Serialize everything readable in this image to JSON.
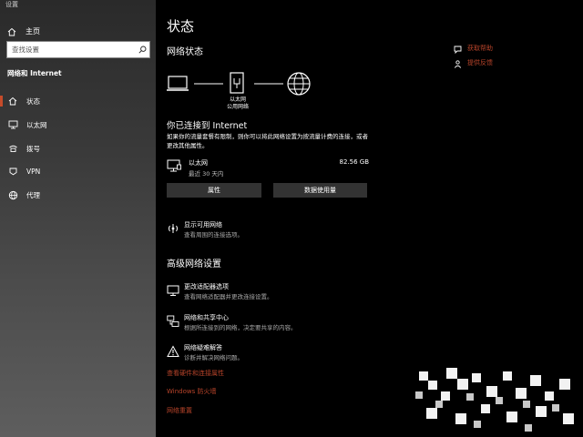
{
  "window": {
    "title": "设置"
  },
  "sidebar": {
    "home_label": "主页",
    "search_placeholder": "查找设置",
    "section_title": "网络和 Internet",
    "items": [
      {
        "label": "状态",
        "icon": "home-status-icon",
        "active": true
      },
      {
        "label": "以太网",
        "icon": "ethernet-icon"
      },
      {
        "label": "拨号",
        "icon": "dialup-icon"
      },
      {
        "label": "VPN",
        "icon": "vpn-icon"
      },
      {
        "label": "代理",
        "icon": "globe-icon"
      }
    ]
  },
  "main": {
    "title": "状态",
    "network_status_heading": "网络状态",
    "diagram": {
      "label_line1": "以太网",
      "label_line2": "公用网络"
    },
    "connected_heading": "你已连接到 Internet",
    "connected_desc": "如果你的流量套餐有限制，则你可以将此网络设置为按流量计费的连接，或者更改其他属性。",
    "adapter": {
      "name": "以太网",
      "subtitle": "最近 30 天内",
      "usage": "82.56 GB"
    },
    "buttons": {
      "properties": "属性",
      "data_usage": "数据使用量"
    },
    "show_networks": {
      "title": "显示可用网络",
      "desc": "查看周围的连接选项。"
    },
    "advanced_heading": "高级网络设置",
    "advanced_items": [
      {
        "title": "更改适配器选项",
        "desc": "查看网络适配器并更改连接设置。"
      },
      {
        "title": "网络和共享中心",
        "desc": "根据所连接到的网络，决定要共享的内容。"
      },
      {
        "title": "网络疑难解答",
        "desc": "诊断并解决网络问题。"
      }
    ],
    "links": [
      "查看硬件和连接属性",
      "Windows 防火墙",
      "网络重置"
    ],
    "help": {
      "get_help": "获取帮助",
      "feedback": "提供反馈"
    }
  },
  "colors": {
    "accent": "#c64b2a",
    "link": "#b8442a",
    "sidebar_top": "#2a2a2a",
    "sidebar_bottom": "#5e5e5e",
    "button_bg": "#333333"
  }
}
